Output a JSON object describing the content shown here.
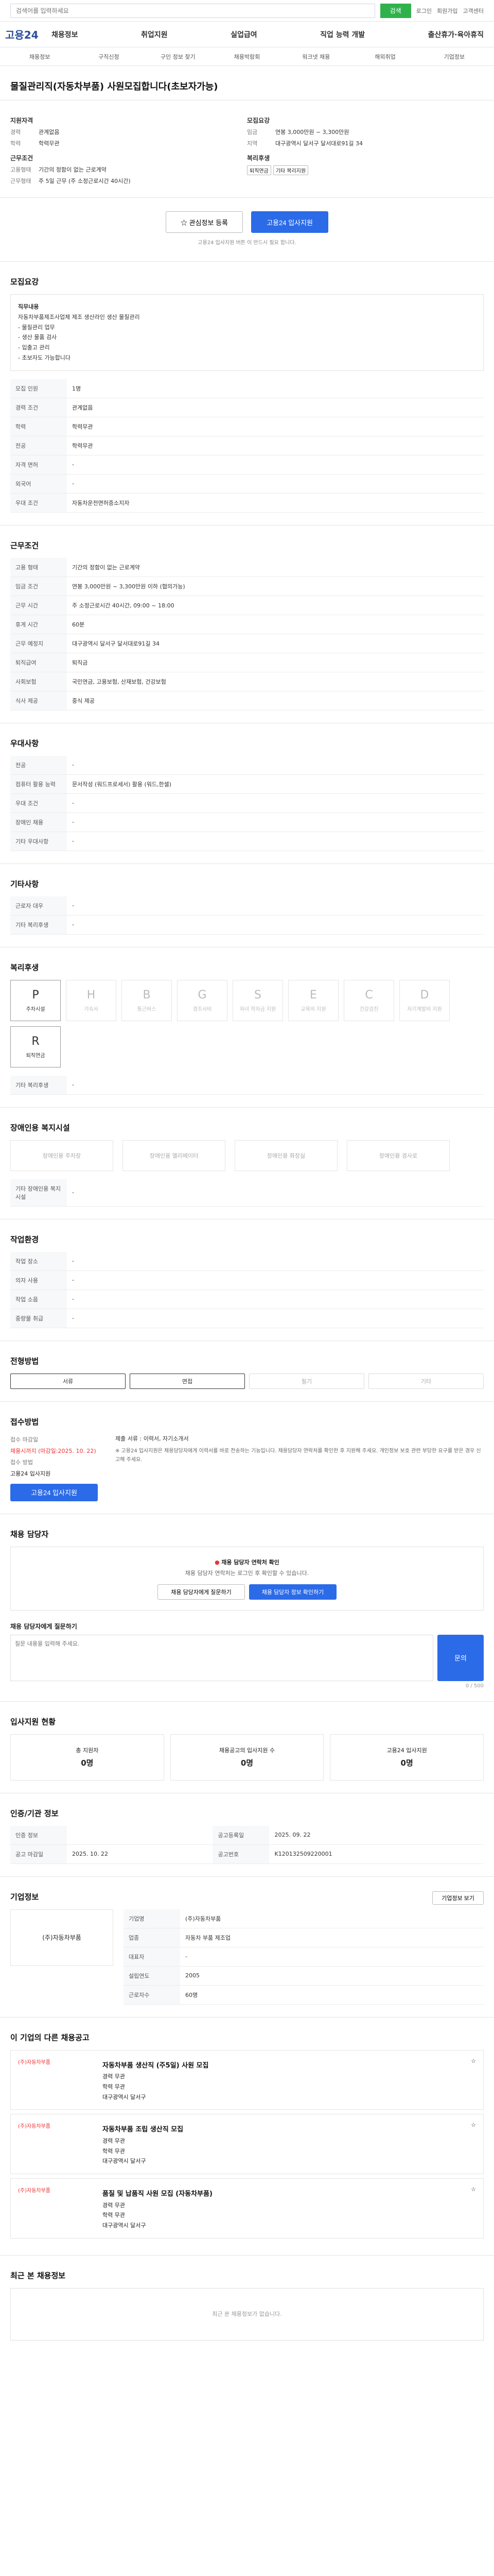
{
  "header": {
    "search_placeholder": "검색어를 입력하세요",
    "search_button": "검색",
    "top_links": [
      "로그인",
      "회원가입",
      "고객센터"
    ],
    "logo": "고용24",
    "menu": [
      "채용정보",
      "취업지원",
      "실업급여",
      "직업 능력 개발",
      "출산휴가·육아휴직"
    ],
    "subnav": [
      "채용정보",
      "구직신청",
      "구인 정보 찾기",
      "채용박람회",
      "워크넷 채용",
      "해외취업",
      "기업정보"
    ]
  },
  "title": "물질관리직(자동차부품) 사원모집합니다(초보자가능)",
  "summary": {
    "left_h": "지원자격",
    "exp_k": "경력",
    "exp_v": "관계없음",
    "edu_k": "학력",
    "edu_v": "학력무관",
    "cond_h": "근무조건",
    "emp_k": "고용형태",
    "emp_v": "기간의 정함이 없는 근로계약",
    "time_k": "근무형태",
    "time_v": "주 5일 근무 (주 소정근로시간 40시간)",
    "right_h": "모집요강",
    "pay_k": "임금",
    "pay_v": "연봉 3,000만원 ~ 3,300만원",
    "loc_k": "지역",
    "loc_v": "대구광역시 달서구 달서대로91길 34",
    "benefit_h": "복리후생",
    "tags": [
      "퇴직연금",
      "기타 복리지원"
    ]
  },
  "actions": {
    "save": "관심정보 등록",
    "apply": "고용24 입사지원"
  },
  "note": "고용24 입사지원 버튼 이 반드시 필요 합니다.",
  "detail": {
    "h": "모집요강",
    "sub": "직무내용",
    "body": [
      "자동차부품제조사업체 제조 생산라인 생산 물질관리",
      "- 물질관리 업무",
      "- 생산 물품 검사",
      "- 입출고 관리",
      "- 초보자도 가능합니다"
    ],
    "rows": [
      [
        "모집 인원",
        "1명"
      ],
      [
        "경력 조건",
        "관계없음"
      ],
      [
        "학력",
        "학력무관"
      ],
      [
        "전공",
        "학력무관"
      ],
      [
        "자격 면허",
        "-"
      ],
      [
        "외국어",
        "-"
      ],
      [
        "우대 조건",
        "자동차운전면허증소지자"
      ]
    ]
  },
  "cond": {
    "h": "근무조건",
    "rows": [
      [
        "고용 형태",
        "기간의 정함이 없는 근로계약"
      ],
      [
        "임금 조건",
        "연봉 3,000만원 ~ 3,300만원 이하 (협의가능)"
      ],
      [
        "근무 시간",
        "주 소정근로시간 40시간, 09:00 ~ 18:00"
      ],
      [
        "휴게 시간",
        "60분"
      ],
      [
        "근무 예정지",
        "대구광역시 달서구 달서대로91길 34"
      ],
      [
        "퇴직급여",
        "퇴직금"
      ],
      [
        "사회보험",
        "국민연금, 고용보험, 산재보험, 건강보험"
      ],
      [
        "식사 제공",
        "중식 제공"
      ]
    ]
  },
  "pref": {
    "h": "우대사항",
    "rows": [
      [
        "전공",
        "-"
      ],
      [
        "컴퓨터 활용 능력",
        "문서작성 (워드프로세서) 활용 (워드,한셀)"
      ],
      [
        "우대 조건",
        "-"
      ],
      [
        "장애인 채용",
        "-"
      ],
      [
        "기타 우대사항",
        "-"
      ]
    ]
  },
  "etc": {
    "h": "기타사항",
    "rows": [
      [
        "근로자 대우",
        "-"
      ],
      [
        "기타 복리후생",
        "-"
      ]
    ]
  },
  "benefits": {
    "h": "복리후생",
    "items": [
      [
        "주차시설",
        "P",
        true
      ],
      [
        "기숙사",
        "H",
        false
      ],
      [
        "통근버스",
        "B",
        false
      ],
      [
        "경조사비",
        "G",
        false
      ],
      [
        "자녀 학자금 지원",
        "S",
        false
      ],
      [
        "교육비 지원",
        "E",
        false
      ],
      [
        "건강검진",
        "C",
        false
      ],
      [
        "자기계발비 지원",
        "D",
        false
      ],
      [
        "퇴직연금",
        "R",
        true
      ]
    ],
    "extra_k": "기타 복리후생",
    "extra_v": "-"
  },
  "disab": {
    "h": "장애인용 복지시설",
    "items": [
      "장애인용 주차장",
      "장애인용 엘리베이터",
      "장애인용 화장실",
      "장애인용 경사로"
    ],
    "extra_k": "기타 장애인용 복지시설",
    "extra_v": "-"
  },
  "work": {
    "h": "작업환경",
    "rows": [
      [
        "작업 장소",
        "-"
      ],
      [
        "의자 사용",
        "-"
      ],
      [
        "작업 소음",
        "-"
      ],
      [
        "중량물 취급",
        "-"
      ]
    ]
  },
  "process": {
    "h": "전형방법",
    "steps": [
      "서류",
      "면접",
      "필기",
      "기타"
    ],
    "on": [
      true,
      true,
      false,
      false
    ]
  },
  "receipt": {
    "h": "접수방법",
    "deadline_k": "접수 마감일",
    "deadline_v": "채용시까지 (마감일:2025. 10. 22)",
    "method_k": "접수 방법",
    "method_v": "고용24 입사지원",
    "docs_k": "제출 서류",
    "docs_v": "이력서, 자기소개서",
    "btn": "고용24 입사지원",
    "notice": "※ 고용24 입사지원은 채용담당자에게 이력서를 바로 전송하는 기능입니다. 채용담당자 연락처를 확인한 후 지원해 주세요. 개인정보 보호 관련 부당한 요구를 받은 경우 신고해 주세요."
  },
  "contact": {
    "h": "채용 담당자",
    "alert": "채용 담당자 연락처 확인",
    "alert_sub": "채용 담당자 연락처는 로그인 후 확인할 수 있습니다.",
    "btn1": "채용 담당자에게 질문하기",
    "btn2": "채용 담당자 정보 확인하기"
  },
  "qna": {
    "h": "채용 담당자에게 질문하기",
    "placeholder": "질문 내용을 입력해 주세요.",
    "btn": "문의",
    "count": "0 / 500"
  },
  "applicants": {
    "h": "입사지원 현황",
    "items": [
      [
        "총 지원자",
        "0명"
      ],
      [
        "채용공고의 입사지원 수",
        "0명"
      ],
      [
        "고용24 입사지원",
        "0명"
      ]
    ]
  },
  "info": {
    "h": "인증/기관 정보",
    "rows": [
      [
        "인증 정보",
        "",
        "공고등록일",
        "2025. 09. 22"
      ],
      [
        "공고 마감일",
        "2025. 10. 22",
        "공고번호",
        "K120132509220001"
      ]
    ]
  },
  "company": {
    "h": "기업정보",
    "name": "(주)자동차부품",
    "rows": [
      [
        "기업명",
        "(주)자동차부품"
      ],
      [
        "업종",
        "자동차 부품 제조업"
      ],
      [
        "대표자",
        "-"
      ],
      [
        "설립연도",
        "2005"
      ],
      [
        "근로자수",
        "60명"
      ]
    ],
    "btn": "기업정보 보기"
  },
  "recs": {
    "h": "이 기업의 다른 채용공고",
    "items": [
      {
        "org": "(주)자동차부품",
        "title": "자동차부품 생산직 (주5일) 사원 모집",
        "info": [
          "경력 무관",
          "학력 무관",
          "대구광역시 달서구"
        ]
      },
      {
        "org": "(주)자동차부품",
        "title": "자동차부품 조립 생산직 모집",
        "info": [
          "경력 무관",
          "학력 무관",
          "대구광역시 달서구"
        ]
      },
      {
        "org": "(주)자동차부품",
        "title": "품질 및 납품직 사원 모집 (자동차부품)",
        "info": [
          "경력 무관",
          "학력 무관",
          "대구광역시 달서구"
        ]
      }
    ]
  },
  "recent": {
    "h": "최근 본 채용정보",
    "empty": "최근 본 채용정보가 없습니다."
  }
}
